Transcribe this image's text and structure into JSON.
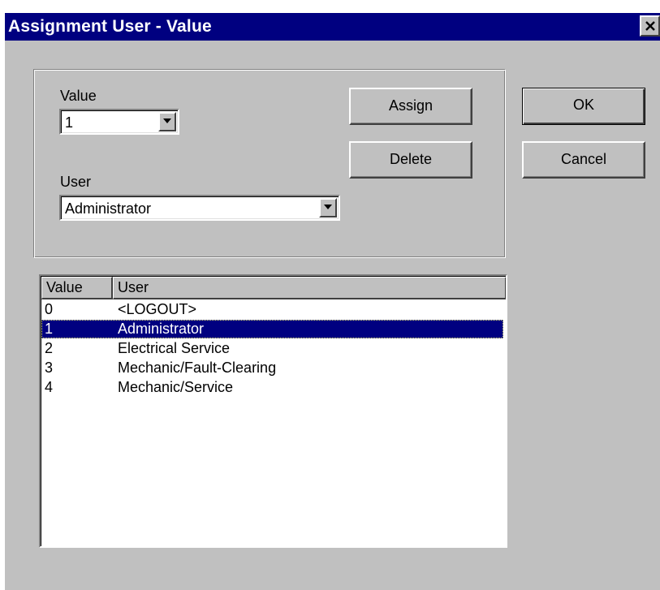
{
  "window": {
    "title": "Assignment User - Value",
    "close_icon": "close-icon"
  },
  "form": {
    "value_label": "Value",
    "value_selected": "1",
    "user_label": "User",
    "user_selected": "Administrator"
  },
  "buttons": {
    "assign": "Assign",
    "delete": "Delete",
    "ok": "OK",
    "cancel": "Cancel"
  },
  "list": {
    "columns": [
      "Value",
      "User"
    ],
    "rows": [
      {
        "value": "0",
        "user": "<LOGOUT>"
      },
      {
        "value": "1",
        "user": "Administrator",
        "selected": true
      },
      {
        "value": "2",
        "user": "Electrical Service"
      },
      {
        "value": "3",
        "user": "Mechanic/Fault-Clearing"
      },
      {
        "value": "4",
        "user": "Mechanic/Service"
      }
    ]
  },
  "colors": {
    "titlebar": "#000080",
    "dialog_face": "#c0c0c0",
    "selection": "#000080"
  }
}
